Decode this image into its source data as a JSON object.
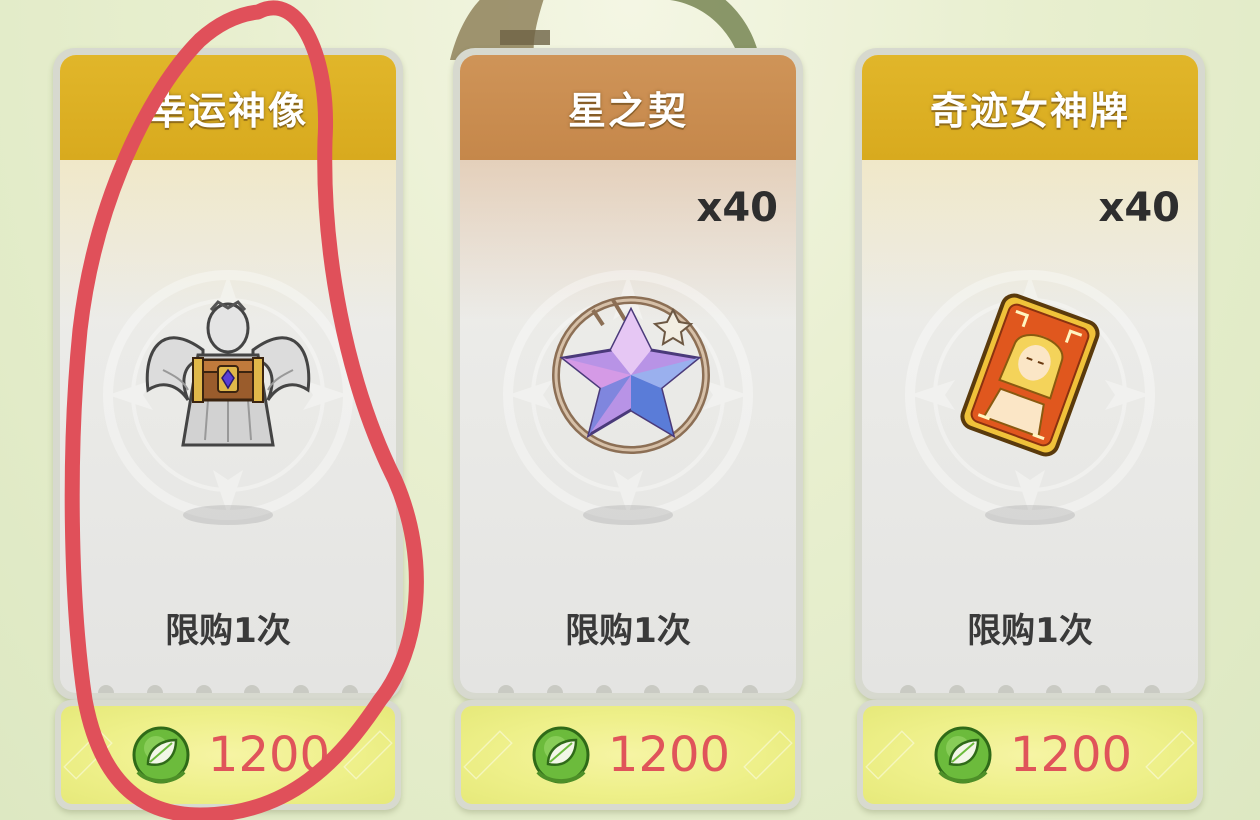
{
  "shop": {
    "items": [
      {
        "title": "幸运神像",
        "quantity": "",
        "limit": "限购1次",
        "price": "1200",
        "icon": "angel-statue-chest-icon",
        "header_color": "#dcb023"
      },
      {
        "title": "星之契",
        "quantity": "x40",
        "limit": "限购1次",
        "price": "1200",
        "icon": "star-crystal-icon",
        "header_color": "#c98d50"
      },
      {
        "title": "奇迹女神牌",
        "quantity": "x40",
        "limit": "限购1次",
        "price": "1200",
        "icon": "goddess-card-icon",
        "header_color": "#dcb023"
      }
    ],
    "currency_icon": "leaf-orb-icon",
    "colors": {
      "price_text": "#e0545a",
      "annotation_stroke": "#e0505a"
    }
  }
}
